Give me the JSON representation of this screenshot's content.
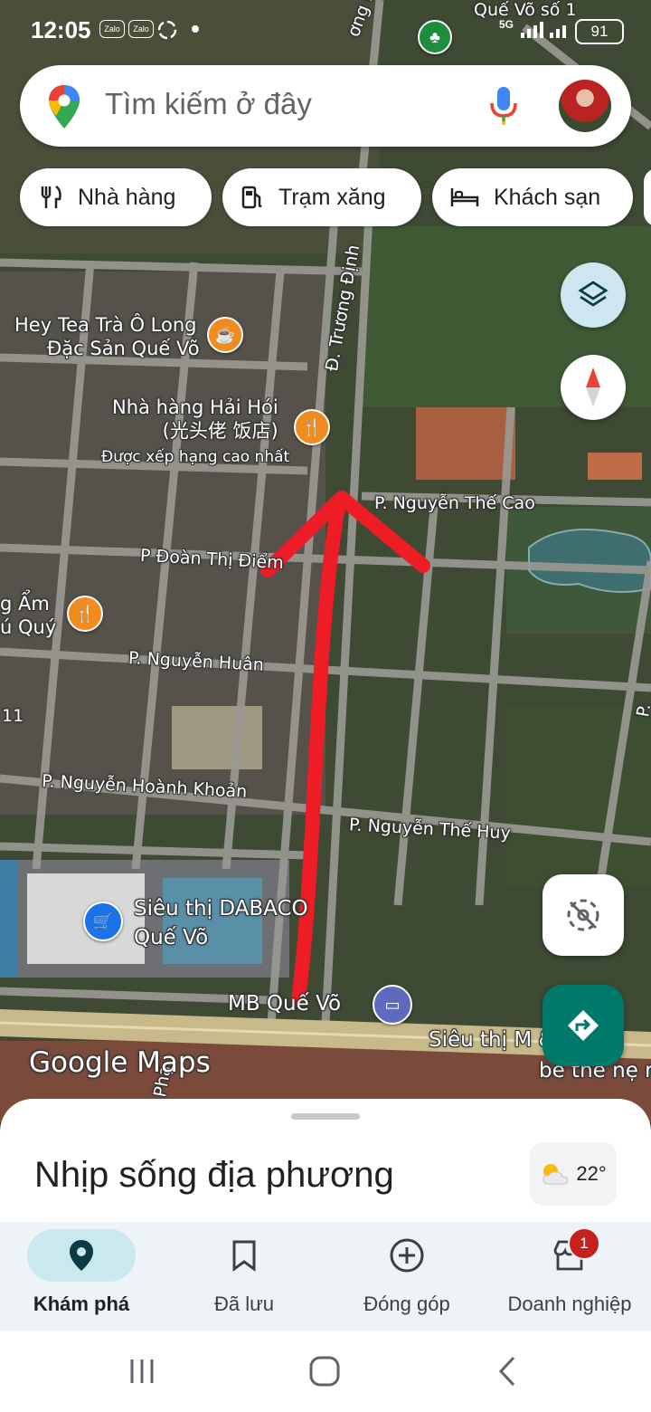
{
  "status_bar": {
    "time": "12:05",
    "app_icons": [
      "Zalo",
      "Zalo"
    ],
    "battery": "91",
    "network": "5G",
    "area_label": "Quế Võ số 1"
  },
  "search": {
    "placeholder": "Tìm kiếm ở đây"
  },
  "chips": [
    {
      "label": "Nhà hàng",
      "icon": "restaurant-icon"
    },
    {
      "label": "Trạm xăng",
      "icon": "gas-station-icon"
    },
    {
      "label": "Khách sạn",
      "icon": "hotel-icon"
    }
  ],
  "map": {
    "streets": {
      "truong_dinh": "Đ. Trương Định",
      "nguyen_the_cao": "P. Nguyễn Thế Cao",
      "doan_thi_diem": "P Đoàn Thị Điểm",
      "nguyen_huan": "P. Nguyễn Huân",
      "nguyen_hoanh_khoan": "P. Nguyễn Hoành Khoản",
      "nguyen_the_huy": "P. Nguyễn Thế Huy",
      "dinh_top": "ơng Định",
      "pha": "Phạ",
      "edge_11": "11",
      "edge_p": "P."
    },
    "places": {
      "heytea_line1": "Hey Tea Trà Ô Long",
      "heytea_line2": "Đặc Sản Quế Võ",
      "haihoi_line1": "Nhà hàng Hải Hói",
      "haihoi_line2": "(光头佬 饭店)",
      "haihoi_note": "Được xếp hạng cao nhất",
      "am_line1": "g Ẩm",
      "am_line2": "ú Quý",
      "dabaco_line1": "Siêu thị DABACO",
      "dabaco_line2": "Quế Võ",
      "mb": "MB Quế Võ",
      "sieuthi_m_line1": "Siêu thị M & B",
      "sieuthi_m_line2": "bé the nẹ mớ"
    },
    "watermark": "Google Maps"
  },
  "sheet": {
    "title": "Nhịp sống địa phương",
    "temperature": "22°"
  },
  "nav": {
    "items": [
      {
        "label": "Khám phá",
        "active": true
      },
      {
        "label": "Đã lưu",
        "active": false
      },
      {
        "label": "Đóng góp",
        "active": false
      },
      {
        "label": "Doanh nghiệp",
        "active": false
      }
    ],
    "badge": "1"
  },
  "colors": {
    "accent": "#00796b",
    "arrow": "#ee1c25",
    "poi_orange": "#f08b1d",
    "poi_blue": "#1a73e8",
    "nav_active_bg": "#c9e9ee"
  }
}
